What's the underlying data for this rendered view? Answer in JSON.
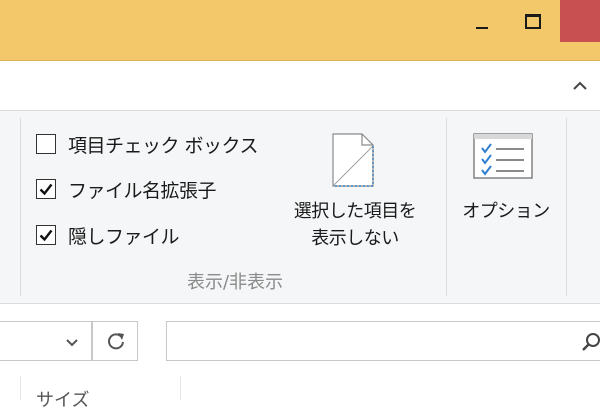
{
  "window": {
    "minimize_icon": "minimize-icon",
    "maximize_icon": "maximize-icon",
    "close_icon": "close-icon",
    "titlebar_color": "#f2c86a",
    "close_color": "#c95050"
  },
  "ribbon": {
    "collapse_icon": "chevron-up-icon",
    "show_hide_group": {
      "label": "表示/非表示",
      "checkboxes": [
        {
          "label": "項目チェック ボックス",
          "checked": false
        },
        {
          "label": "ファイル名拡張子",
          "checked": true
        },
        {
          "label": "隠しファイル",
          "checked": true
        }
      ],
      "hide_selected": {
        "line1": "選択した項目を",
        "line2": "表示しない",
        "icon": "hide-document-icon"
      }
    },
    "options": {
      "label": "オプション",
      "icon": "options-checklist-icon"
    }
  },
  "address_bar": {
    "dropdown_icon": "chevron-down-icon",
    "refresh_icon": "refresh-icon"
  },
  "search": {
    "icon": "search-icon"
  },
  "columns": {
    "size_header": "サイズ"
  }
}
